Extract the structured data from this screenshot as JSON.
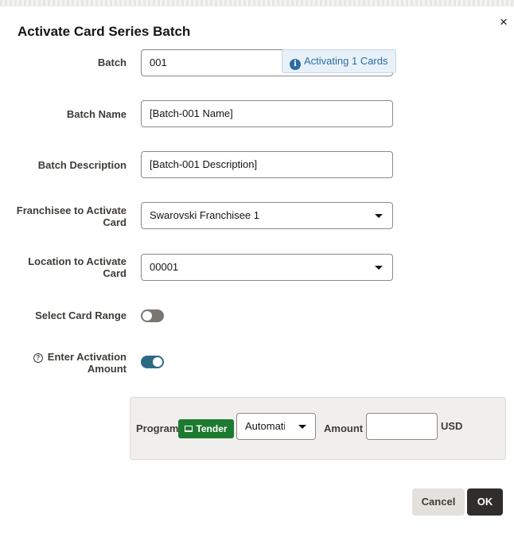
{
  "dialog": {
    "title": "Activate Card Series Batch",
    "close_label": "×"
  },
  "form": {
    "batch": {
      "label": "Batch",
      "value": "001"
    },
    "activating_badge": "Activating 1 Cards",
    "batch_name": {
      "label": "Batch Name",
      "value": "[Batch-001 Name]"
    },
    "batch_description": {
      "label": "Batch Description",
      "value": "[Batch-001 Description]"
    },
    "franchisee": {
      "label": "Franchisee to Activate Card",
      "value": "Swarovski Franchisee 1"
    },
    "location": {
      "label": "Location to Activate Card",
      "value": "00001"
    },
    "select_card_range": {
      "label": "Select Card Range",
      "state": "off"
    },
    "enter_activation_amount": {
      "label": "Enter Activation Amount",
      "state": "on"
    }
  },
  "amount_panel": {
    "program_label": "Program",
    "tender_label": "Tender",
    "mode_value": "Automatic",
    "amount_label": "Amount",
    "amount_value": "",
    "currency": "USD"
  },
  "footer": {
    "cancel_label": "Cancel",
    "ok_label": "OK"
  },
  "colors": {
    "toggle_on": "#2c6a84",
    "toggle_off": "#7a7773",
    "tender_green": "#1d7a31",
    "info_blue": "#2b6da3",
    "ok_button": "#312d2a"
  }
}
